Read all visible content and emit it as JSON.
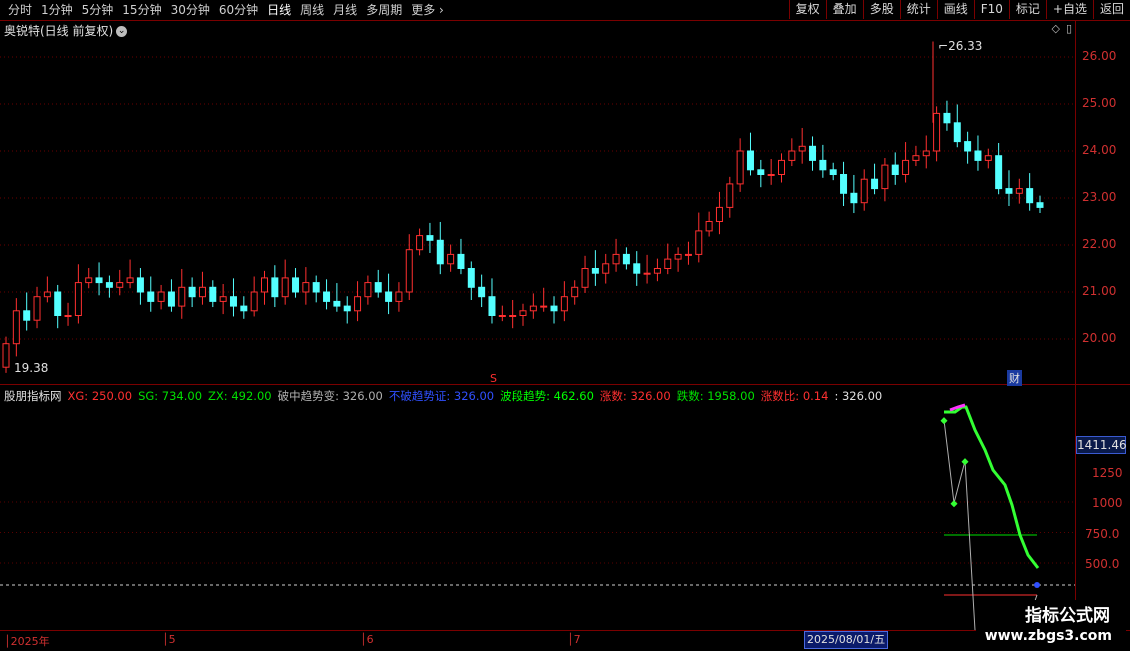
{
  "toolbar": {
    "periods": [
      "分时",
      "1分钟",
      "5分钟",
      "15分钟",
      "30分钟",
      "60分钟",
      "日线",
      "周线",
      "月线",
      "多周期",
      "更多 ›"
    ],
    "active": "日线",
    "buttons": [
      "复权",
      "叠加",
      "多股",
      "统计",
      "画线",
      "F10",
      "标记",
      "+自选",
      "返回"
    ]
  },
  "stock": {
    "title": "奥锐特(日线 前复权)",
    "dropdown_icon": "chevron-down-icon"
  },
  "price_axis": {
    "labels": [
      "26.00",
      "25.00",
      "24.00",
      "23.00",
      "22.00",
      "21.00",
      "20.00"
    ],
    "high_label": "26.33",
    "low_label": "19.38"
  },
  "indicator_header": [
    {
      "text": "股朋指标网",
      "color": "#e0e0e0"
    },
    {
      "text": "XG: 250.00",
      "color": "#ff3030"
    },
    {
      "text": "SG: 734.00",
      "color": "#00e000"
    },
    {
      "text": "ZX: 492.00",
      "color": "#00e000"
    },
    {
      "text": "破中趋势变: 326.00",
      "color": "#b0b0b0"
    },
    {
      "text": "不破趋势证: 326.00",
      "color": "#3050ff"
    },
    {
      "text": "波段趋势: 462.60",
      "color": "#00ff00"
    },
    {
      "text": "涨数: 326.00",
      "color": "#ff3030"
    },
    {
      "text": "跌数: 1958.00",
      "color": "#00e000"
    },
    {
      "text": "涨数比: 0.14",
      "color": "#ff3030"
    },
    {
      "text": ": 326.00",
      "color": "#e0e0e0"
    }
  ],
  "indicator_axis": {
    "current": "1411.46",
    "labels": [
      "1250",
      "1000",
      "750.0",
      "500.0"
    ]
  },
  "date_axis": {
    "labels": [
      "2025年",
      "5",
      "6",
      "7"
    ],
    "selected": "2025/08/01/五"
  },
  "markers": {
    "s": "S",
    "cai": "财"
  },
  "watermark": {
    "line1": "指标公式网",
    "line2": "www.zbgs3.com"
  },
  "colors": {
    "up": "#ff3030",
    "down": "#54ffff",
    "grid": "#7a0000",
    "selected": "#0a1a6a"
  }
}
